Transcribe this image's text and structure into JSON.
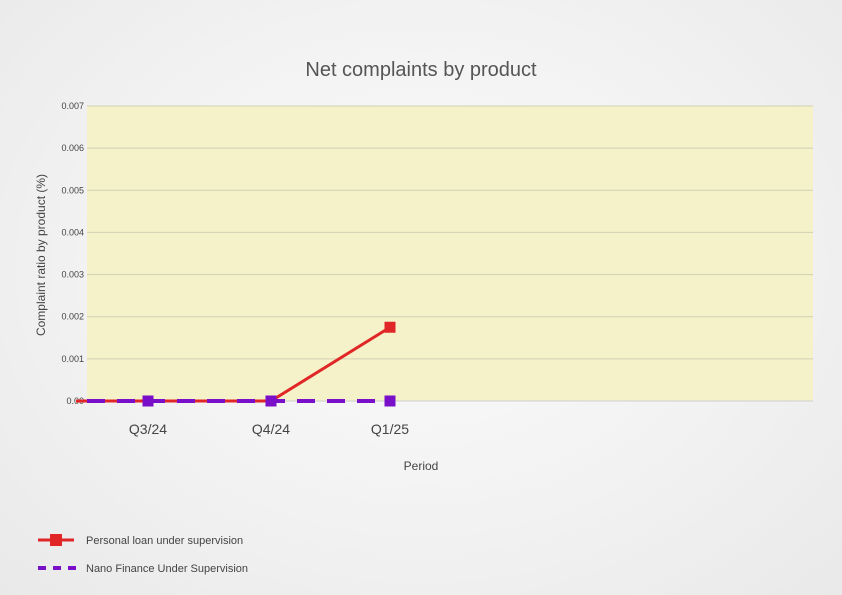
{
  "chart_data": {
    "type": "line",
    "title": "Net complaints by product",
    "xlabel": "Period",
    "ylabel": "Complaint ratio by product (%)",
    "categories": [
      "Q3/24",
      "Q4/24",
      "Q1/25"
    ],
    "ylim": [
      0,
      0.007
    ],
    "yticks": [
      "0.00",
      "0.001",
      "0.002",
      "0.003",
      "0.004",
      "0.005",
      "0.006",
      "0.007"
    ],
    "grid": true,
    "legend_position": "bottom-left",
    "plot_background": "#f5f2c9",
    "series": [
      {
        "name": "Personal loan under supervision",
        "values": [
          0,
          0,
          0.00175
        ],
        "color": "#e02626",
        "style": "solid"
      },
      {
        "name": "Nano Finance Under Supervision",
        "values": [
          0,
          0,
          0
        ],
        "color": "#7a0fc9",
        "style": "dashed"
      }
    ]
  }
}
